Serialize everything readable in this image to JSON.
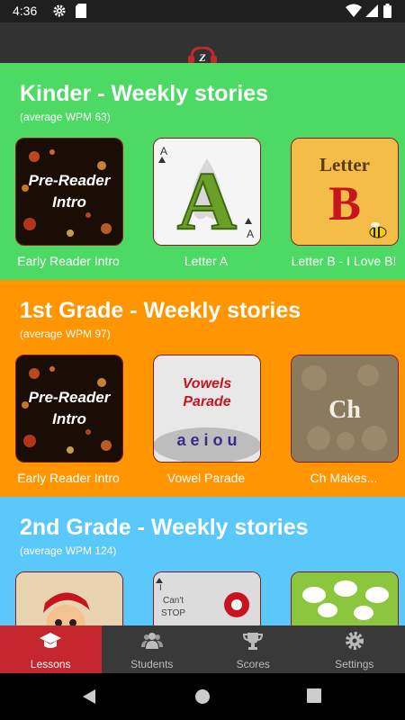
{
  "status_bar": {
    "time": "4:36",
    "icons": [
      "gear-icon",
      "sd-card-icon",
      "wifi-icon",
      "signal-icon",
      "battery-icon"
    ]
  },
  "app_bar": {
    "logo": "headphones-logo"
  },
  "sections": [
    {
      "title": "Kinder - Weekly stories",
      "subtitle": "(average WPM 63)",
      "bg": "#4cd964",
      "cards": [
        {
          "label": "Early Reader Intro",
          "art_text": [
            "Pre-Reader",
            "Intro"
          ]
        },
        {
          "label": "Letter A",
          "art_text": [
            "A"
          ]
        },
        {
          "label": "Letter B - I Love B!",
          "art_text": [
            "Letter",
            "B"
          ]
        }
      ]
    },
    {
      "title": "1st Grade - Weekly stories",
      "subtitle": "(average WPM 97)",
      "bg": "#ff9500",
      "cards": [
        {
          "label": "Early Reader Intro",
          "art_text": [
            "Pre-Reader",
            "Intro"
          ]
        },
        {
          "label": "Vowel Parade",
          "art_text": [
            "Vowels",
            "Parade",
            "a e i o u"
          ]
        },
        {
          "label": "Ch Makes...",
          "art_text": [
            "Ch"
          ]
        }
      ]
    },
    {
      "title": "2nd Grade - Weekly stories",
      "subtitle": "(average WPM 124)",
      "bg": "#5ac8fa",
      "cards": [
        {
          "label": "",
          "art_text": []
        },
        {
          "label": "",
          "art_text": [
            "I",
            "Can't",
            "STOP"
          ]
        },
        {
          "label": "",
          "art_text": []
        }
      ]
    }
  ],
  "tabs": [
    {
      "label": "Lessons",
      "icon": "graduation-cap-icon",
      "active": true
    },
    {
      "label": "Students",
      "icon": "users-icon",
      "active": false
    },
    {
      "label": "Scores",
      "icon": "trophy-icon",
      "active": false
    },
    {
      "label": "Settings",
      "icon": "gear-icon",
      "active": false
    }
  ],
  "nav": {
    "buttons": [
      "back-icon",
      "home-icon",
      "recents-icon"
    ]
  },
  "colors": {
    "active_tab": "#c6262e",
    "tab_bar": "#393939",
    "app_bar": "#323232",
    "card_border": "#8a1a1a"
  }
}
